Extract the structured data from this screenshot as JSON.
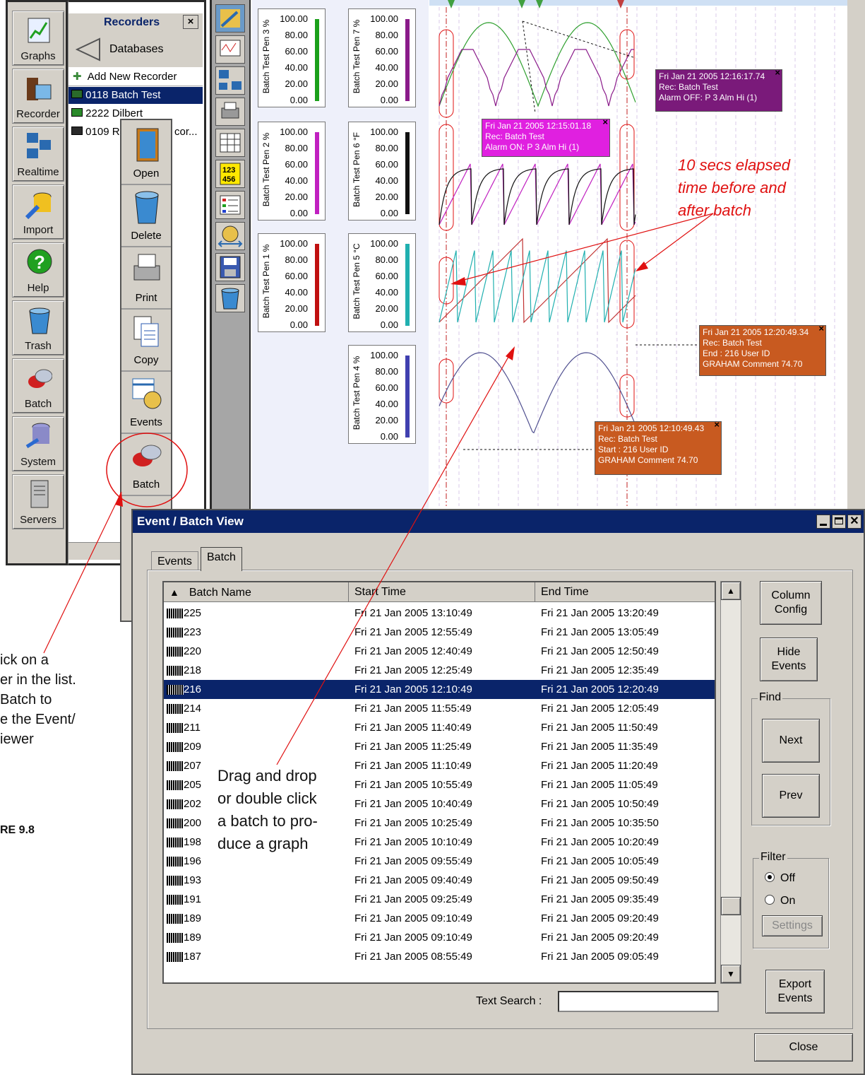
{
  "left_nav": [
    {
      "label": "Graphs",
      "icon": "graph-icon"
    },
    {
      "label": "Recorder",
      "icon": "recorder-icon"
    },
    {
      "label": "Realtime",
      "icon": "realtime-icon"
    },
    {
      "label": "Import",
      "icon": "import-icon"
    },
    {
      "label": "Help",
      "icon": "help-icon"
    },
    {
      "label": "Trash",
      "icon": "trash-icon"
    },
    {
      "label": "Batch",
      "icon": "batch-icon"
    },
    {
      "label": "System",
      "icon": "system-icon"
    },
    {
      "label": "Servers",
      "icon": "servers-icon"
    }
  ],
  "recorders": {
    "title": "Recorders",
    "close": "×",
    "databases": "Databases",
    "add_new": "Add New Recorder",
    "items": [
      "0118 Batch Test",
      "2222 Dilbert",
      "0109 R"
    ],
    "item3_tail": "cor..."
  },
  "context_menu": [
    "Open",
    "Delete",
    "Print",
    "Copy",
    "Events",
    "Batch"
  ],
  "scales": {
    "ticks": [
      "100.00",
      "80.00",
      "60.00",
      "40.00",
      "20.00",
      "0.00"
    ],
    "pens": [
      {
        "label": "Batch Test Pen 3 %",
        "color": "#1aa01a"
      },
      {
        "label": "Batch Test Pen 7 %",
        "color": "#8a1a8a"
      },
      {
        "label": "Batch Test Pen 2 %",
        "color": "#c020c0"
      },
      {
        "label": "Batch Test Pen 6 °F",
        "color": "#111111"
      },
      {
        "label": "Batch Test Pen 1 %",
        "color": "#c01010"
      },
      {
        "label": "Batch Test Pen 5 °C",
        "color": "#20b0b0"
      },
      {
        "label": "Batch Test Pen 4 %",
        "color": "#4040b0"
      }
    ]
  },
  "tooltips": [
    {
      "lines": [
        "Fri Jan 21 2005 12:16:17.74",
        "Rec: Batch Test",
        "Alarm OFF: P 3 Alm Hi (1)"
      ],
      "color": "#7a1a7a"
    },
    {
      "lines": [
        "Fri Jan 21 2005 12:15:01.18",
        "Rec: Batch Test",
        "Alarm ON: P 3 Alm Hi (1)"
      ],
      "color": "#e020e0"
    },
    {
      "lines": [
        "Fri Jan 21 2005 12:20:49.34",
        "Rec: Batch Test",
        "End : 216 User ID",
        "GRAHAM Comment 74.70"
      ],
      "color": "#c85a20"
    },
    {
      "lines": [
        "Fri Jan 21 2005 12:10:49.43",
        "Rec: Batch Test",
        "Start : 216 User ID",
        "GRAHAM Comment 74.70"
      ],
      "color": "#c85a20"
    }
  ],
  "annotations": {
    "elapsed": [
      "10 secs elapsed",
      "time before and",
      "after batch"
    ],
    "drag": [
      "Drag and drop",
      "or double click",
      "a batch to pro-",
      "duce a graph"
    ],
    "left": [
      "ick on a",
      "er in the list.",
      "Batch to",
      "e the Event/",
      "iewer"
    ],
    "figure": "RE 9.8"
  },
  "dialog": {
    "title": "Event / Batch View",
    "tabs": [
      "Events",
      "Batch"
    ],
    "columns": [
      "Batch Name",
      "Start Time",
      "End Time"
    ],
    "rows": [
      [
        "225",
        "Fri 21 Jan 2005 13:10:49",
        "Fri 21 Jan 2005 13:20:49"
      ],
      [
        "223",
        "Fri 21 Jan 2005 12:55:49",
        "Fri 21 Jan 2005 13:05:49"
      ],
      [
        "220",
        "Fri 21 Jan 2005 12:40:49",
        "Fri 21 Jan 2005 12:50:49"
      ],
      [
        "218",
        "Fri 21 Jan 2005 12:25:49",
        "Fri 21 Jan 2005 12:35:49"
      ],
      [
        "216",
        "Fri 21 Jan 2005 12:10:49",
        "Fri 21 Jan 2005 12:20:49"
      ],
      [
        "214",
        "Fri 21 Jan 2005 11:55:49",
        "Fri 21 Jan 2005 12:05:49"
      ],
      [
        "211",
        "Fri 21 Jan 2005 11:40:49",
        "Fri 21 Jan 2005 11:50:49"
      ],
      [
        "209",
        "Fri 21 Jan 2005 11:25:49",
        "Fri 21 Jan 2005 11:35:49"
      ],
      [
        "207",
        "Fri 21 Jan 2005 11:10:49",
        "Fri 21 Jan 2005 11:20:49"
      ],
      [
        "205",
        "Fri 21 Jan 2005 10:55:49",
        "Fri 21 Jan 2005 11:05:49"
      ],
      [
        "202",
        "Fri 21 Jan 2005 10:40:49",
        "Fri 21 Jan 2005 10:50:49"
      ],
      [
        "200",
        "Fri 21 Jan 2005 10:25:49",
        "Fri 21 Jan 2005 10:35:50"
      ],
      [
        "198",
        "Fri 21 Jan 2005 10:10:49",
        "Fri 21 Jan 2005 10:20:49"
      ],
      [
        "196",
        "Fri 21 Jan 2005 09:55:49",
        "Fri 21 Jan 2005 10:05:49"
      ],
      [
        "193",
        "Fri 21 Jan 2005 09:40:49",
        "Fri 21 Jan 2005 09:50:49"
      ],
      [
        "191",
        "Fri 21 Jan 2005 09:25:49",
        "Fri 21 Jan 2005 09:35:49"
      ],
      [
        "189",
        "Fri 21 Jan 2005 09:10:49",
        "Fri 21 Jan 2005 09:20:49"
      ],
      [
        "189",
        "Fri 21 Jan 2005 09:10:49",
        "Fri 21 Jan 2005 09:20:49"
      ],
      [
        "187",
        "Fri 21 Jan 2005 08:55:49",
        "Fri 21 Jan 2005 09:05:49"
      ]
    ],
    "selected_index": 4,
    "buttons": {
      "column_config": [
        "Column",
        "Config"
      ],
      "hide_events": [
        "Hide",
        "Events"
      ],
      "find": "Find",
      "next": "Next",
      "prev": "Prev",
      "filter": "Filter",
      "off": "Off",
      "on": "On",
      "settings": "Settings",
      "export_events": [
        "Export",
        "Events"
      ],
      "close": "Close"
    },
    "text_search_label": "Text Search :",
    "text_search_value": ""
  }
}
